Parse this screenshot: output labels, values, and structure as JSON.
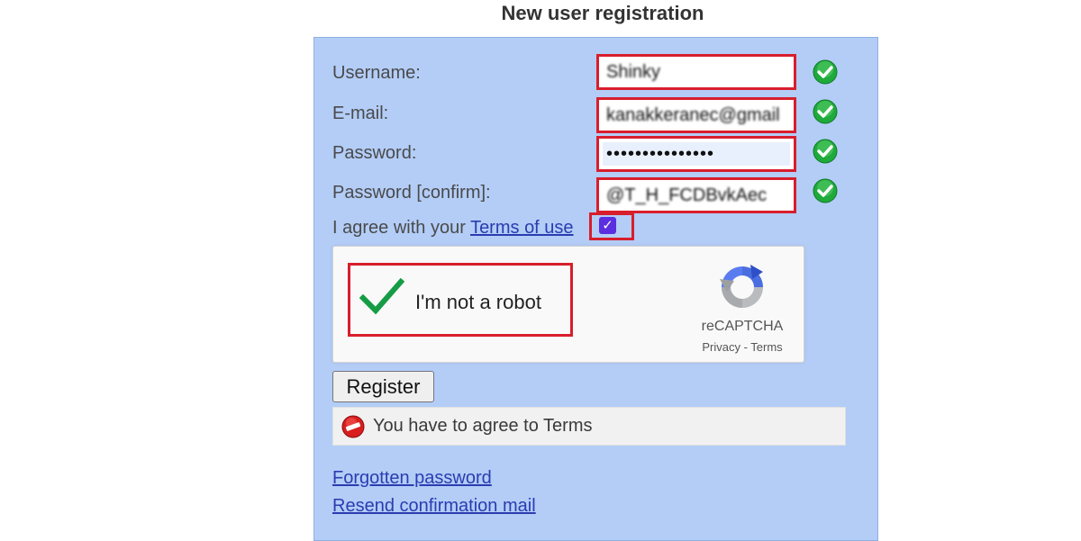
{
  "page": {
    "title": "New user registration"
  },
  "form": {
    "username": {
      "label": "Username:",
      "value": "Shinky"
    },
    "email": {
      "label": "E-mail:",
      "value": "kanakkeranec@gmail"
    },
    "password": {
      "label": "Password:",
      "value": "•••••••••••••••"
    },
    "password_confirm": {
      "label": "Password [confirm]:",
      "value": "@T_H_FCDBvkAec"
    },
    "terms": {
      "prefix": "I agree with your",
      "link_label": "Terms of use",
      "checked": true
    }
  },
  "captcha": {
    "label": "I'm not a robot",
    "brand": "reCAPTCHA",
    "privacy_label": "Privacy",
    "separator": " - ",
    "terms_label": "Terms",
    "checked": true
  },
  "actions": {
    "register_label": "Register"
  },
  "status": {
    "error_text": "You have to agree to Terms",
    "error_icon": "no-entry-icon"
  },
  "links": {
    "forgot_password": "Forgotten password",
    "resend_confirmation": "Resend confirmation mail"
  },
  "colors": {
    "panel_bg": "#b3cdf7",
    "highlight_border": "#d81e2c",
    "link": "#2b3cb0",
    "valid_green": "#1faa3c"
  }
}
